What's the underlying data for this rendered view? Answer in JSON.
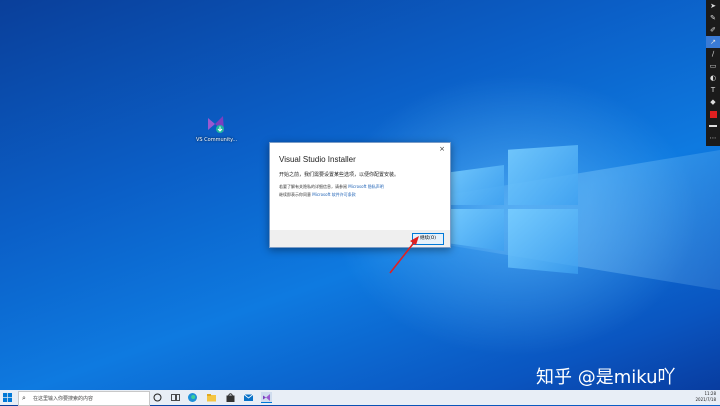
{
  "desktop": {
    "icon_label": "VS Community..."
  },
  "dialog": {
    "title": "Visual Studio Installer",
    "close_glyph": "×",
    "intro": "开始之前，我们需要设置某些选项，以便你配置安装。",
    "line1_text": "若要了解有关隐私的详细信息，请参阅",
    "line1_link": "Microsoft 隐私声明",
    "line2_text": "继续即表示你同意",
    "line2_link": "Microsoft 软件许可条款",
    "continue_label": "继续(O)"
  },
  "taskbar": {
    "search_placeholder": "在这里输入你要搜索的内容",
    "time": "11:28",
    "date": "2021/7/18"
  },
  "watermark": "知乎 @是miku吖",
  "colors": {
    "accent": "#0078d7",
    "arrow": "#e02020",
    "link": "#1a5fb4"
  }
}
